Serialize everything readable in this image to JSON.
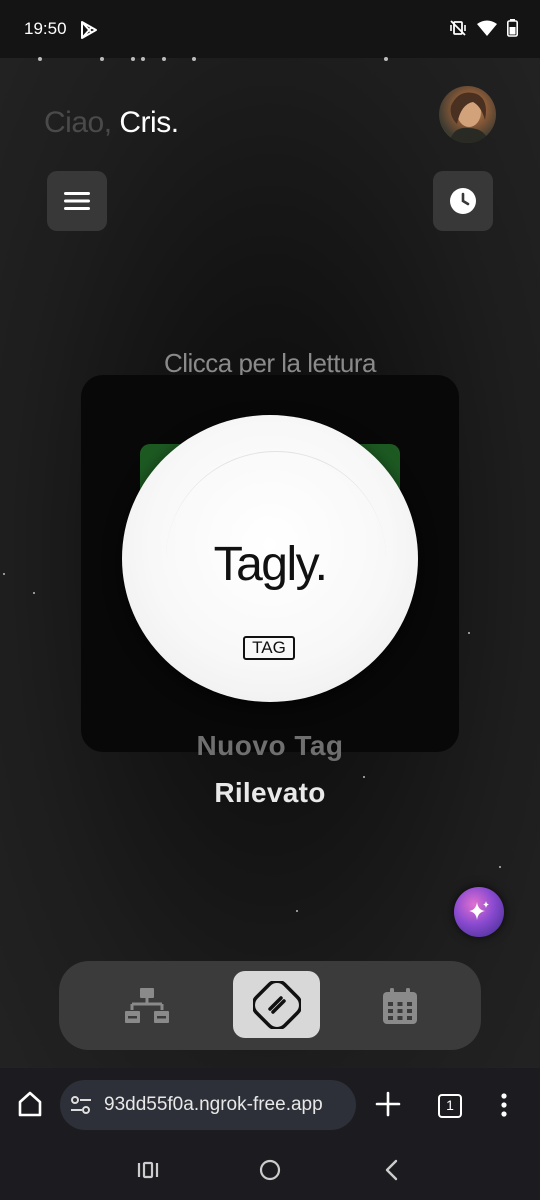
{
  "status_bar": {
    "time": "19:50"
  },
  "greeting": {
    "hello": "Ciao, ",
    "name": "Cris."
  },
  "main": {
    "read_hint": "Clicca per la lettura",
    "tag": {
      "brand": "Tagly.",
      "label": "TAG"
    },
    "status_line1": "Nuovo Tag",
    "status_line2": "Rilevato"
  },
  "bottom_nav": {
    "items": [
      {
        "icon": "network-icon",
        "active": false
      },
      {
        "icon": "nfc-icon",
        "active": true
      },
      {
        "icon": "calendar-icon",
        "active": false
      }
    ]
  },
  "browser": {
    "url": "93dd55f0a.ngrok-free.app",
    "tab_count": "1"
  },
  "colors": {
    "background": "#1b1b1b",
    "card": "#080808",
    "nav_active": "#d8d8d8",
    "green_accent": "#1d5a22"
  }
}
